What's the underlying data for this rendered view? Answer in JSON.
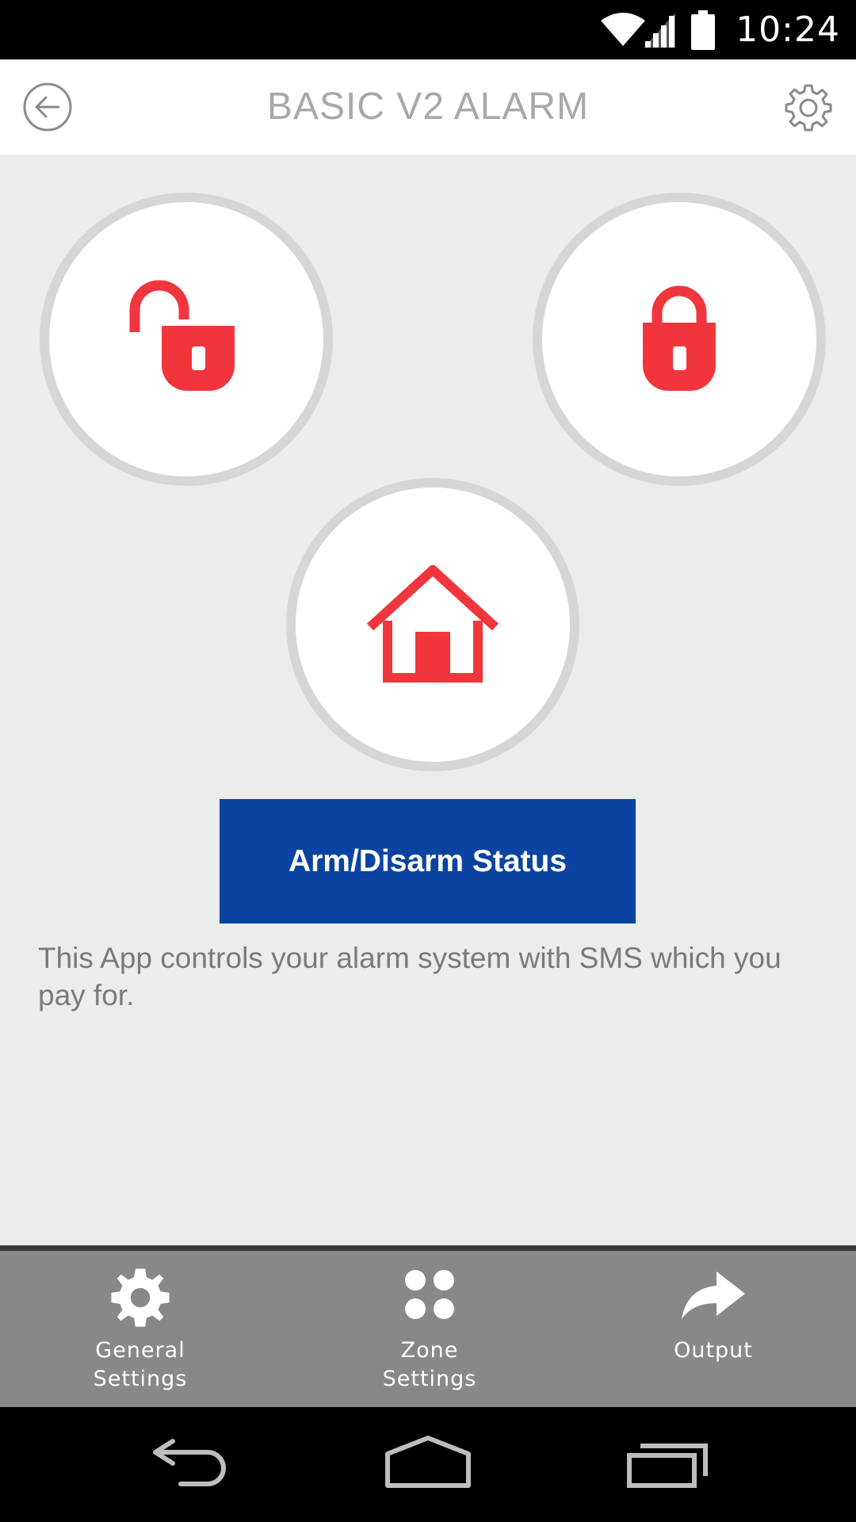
{
  "status_bar": {
    "time": "10:24",
    "icons": [
      "wifi-icon",
      "cell-signal-icon",
      "battery-icon"
    ]
  },
  "header": {
    "title": "BASIC V2 ALARM",
    "back_icon": "back-arrow-circle-icon",
    "settings_icon": "gear-outline-icon"
  },
  "actions": {
    "disarm_icon": "unlocked-padlock-icon",
    "arm_icon": "locked-padlock-icon",
    "home_icon": "house-icon"
  },
  "main": {
    "status_button_label": "Arm/Disarm Status",
    "info_text": "This App controls your alarm system with SMS which you pay for."
  },
  "toolbar": {
    "items": [
      {
        "label": "General\nSettings",
        "icon": "gear-icon"
      },
      {
        "label": "Zone\nSettings",
        "icon": "four-dots-icon"
      },
      {
        "label": "Output",
        "icon": "share-arrow-icon"
      }
    ]
  },
  "nav_bar": {
    "icons": [
      "nav-back-icon",
      "nav-home-icon",
      "nav-recents-icon"
    ]
  },
  "colors": {
    "accent_red": "#f0363c",
    "primary_blue": "#0b44a0",
    "background": "#ececec",
    "toolbar_gray": "#888888"
  }
}
